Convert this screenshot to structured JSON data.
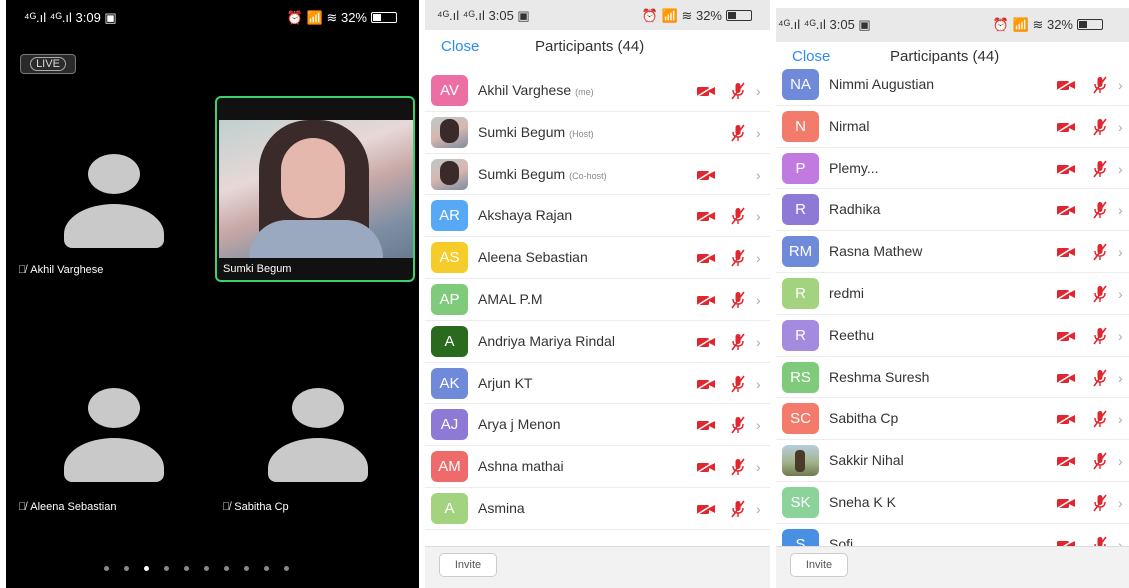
{
  "panel1": {
    "status": {
      "left": "⁴ᴳ.ıl ⁴ᴳ.ıl 3:09 ▣",
      "right": "⏰ 📶 ≋ 32%"
    },
    "live_label": "LIVE",
    "tiles": {
      "akhil": "Akhil Varghese",
      "sumki": "Sumki Begum",
      "aleena": "Aleena Sebastian",
      "sabitha": "Sabitha Cp"
    },
    "page_count": 10,
    "active_page": 2
  },
  "panel2": {
    "status": {
      "left": "⁴ᴳ.ıl ⁴ᴳ.ıl 3:05 ▣",
      "right": "⏰ 📶 ≋ 32%"
    },
    "close_label": "Close",
    "title": "Participants (44)",
    "invite_label": "Invite",
    "participants": [
      {
        "initials": "AV",
        "color": "#ec6fa4",
        "name": "Akhil Varghese",
        "tag": "(me)",
        "cam": true,
        "mic": true
      },
      {
        "initials": "",
        "color": "photo",
        "name": "Sumki Begum",
        "tag": "(Host)",
        "cam": false,
        "mic": true
      },
      {
        "initials": "",
        "color": "photo",
        "name": "Sumki Begum",
        "tag": "(Co-host)",
        "cam": true,
        "mic": false
      },
      {
        "initials": "AR",
        "color": "#58a9f5",
        "name": "Akshaya Rajan",
        "tag": "",
        "cam": true,
        "mic": true
      },
      {
        "initials": "AS",
        "color": "#f6cc2a",
        "name": "Aleena Sebastian",
        "tag": "",
        "cam": true,
        "mic": true
      },
      {
        "initials": "AP",
        "color": "#7fcb7b",
        "name": "AMAL P.M",
        "tag": "",
        "cam": true,
        "mic": true
      },
      {
        "initials": "A",
        "color": "#2a6a1f",
        "name": "Andriya Mariya Rindal",
        "tag": "",
        "cam": true,
        "mic": true
      },
      {
        "initials": "AK",
        "color": "#6f8ad9",
        "name": "Arjun KT",
        "tag": "",
        "cam": true,
        "mic": true
      },
      {
        "initials": "AJ",
        "color": "#8e79d6",
        "name": "Arya j Menon",
        "tag": "",
        "cam": true,
        "mic": true
      },
      {
        "initials": "AM",
        "color": "#ef6a6a",
        "name": "Ashna mathai",
        "tag": "",
        "cam": true,
        "mic": true
      },
      {
        "initials": "A",
        "color": "#a3d37e",
        "name": "Asmina",
        "tag": "",
        "cam": true,
        "mic": true
      }
    ]
  },
  "panel3": {
    "status": {
      "left": "⁴ᴳ.ıl ⁴ᴳ.ıl 3:05 ▣",
      "right": "⏰ 📶 ≋ 32%"
    },
    "close_label": "Close",
    "title": "Participants (44)",
    "invite_label": "Invite",
    "participants": [
      {
        "initials": "NA",
        "color": "#6f8ad9",
        "name": "Nimmi Augustian",
        "tag": "",
        "cam": true,
        "mic": true
      },
      {
        "initials": "N",
        "color": "#f27b6b",
        "name": "Nirmal",
        "tag": "",
        "cam": true,
        "mic": true
      },
      {
        "initials": "P",
        "color": "#c17be0",
        "name": "Plemy...",
        "tag": "",
        "cam": true,
        "mic": true
      },
      {
        "initials": "R",
        "color": "#8e79d6",
        "name": "Radhika",
        "tag": "",
        "cam": true,
        "mic": true
      },
      {
        "initials": "RM",
        "color": "#6f8ad9",
        "name": "Rasna Mathew",
        "tag": "",
        "cam": true,
        "mic": true
      },
      {
        "initials": "R",
        "color": "#a3d37e",
        "name": "redmi",
        "tag": "",
        "cam": true,
        "mic": true
      },
      {
        "initials": "R",
        "color": "#a48be0",
        "name": "Reethu",
        "tag": "",
        "cam": true,
        "mic": true
      },
      {
        "initials": "RS",
        "color": "#7fcb7b",
        "name": "Reshma Suresh",
        "tag": "",
        "cam": true,
        "mic": true
      },
      {
        "initials": "SC",
        "color": "#f27b6b",
        "name": "Sabitha Cp",
        "tag": "",
        "cam": true,
        "mic": true
      },
      {
        "initials": "",
        "color": "photo2",
        "name": "Sakkir Nihal",
        "tag": "",
        "cam": true,
        "mic": true
      },
      {
        "initials": "SK",
        "color": "#8bd39a",
        "name": "Sneha K K",
        "tag": "",
        "cam": true,
        "mic": true
      },
      {
        "initials": "S",
        "color": "#4a90e2",
        "name": "Sofi",
        "tag": "",
        "cam": true,
        "mic": true
      }
    ]
  },
  "colors": {
    "accent": "#2d8cf0",
    "muted_red": "#e0262e",
    "active_border": "#3bd16f"
  }
}
